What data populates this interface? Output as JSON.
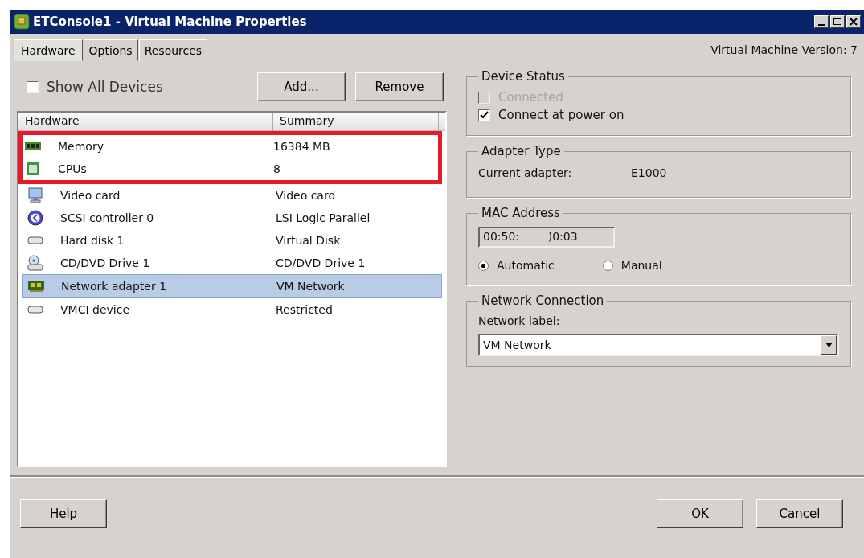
{
  "window": {
    "title": "ETConsole1 - Virtual Machine Properties",
    "version": "Virtual Machine Version: 7"
  },
  "tabs": [
    {
      "label": "Hardware",
      "selected": true
    },
    {
      "label": "Options",
      "selected": false
    },
    {
      "label": "Resources",
      "selected": false
    }
  ],
  "show_all_devices": {
    "label": "Show All Devices",
    "checked": false
  },
  "list_buttons": [
    "Add...",
    "Remove"
  ],
  "table": {
    "columns": [
      "Hardware",
      "Summary"
    ],
    "rows": [
      {
        "kind": "memory",
        "name": "Memory",
        "summary": "16384 MB",
        "selected": false,
        "highlighted": true
      },
      {
        "kind": "cpu",
        "name": "CPUs",
        "summary": "8",
        "selected": false,
        "highlighted": true
      },
      {
        "kind": "video",
        "name": "Video card",
        "summary": "Video card",
        "selected": false,
        "highlighted": false
      },
      {
        "kind": "scsi",
        "name": "SCSI controller 0",
        "summary": "LSI Logic Parallel",
        "selected": false,
        "highlighted": false
      },
      {
        "kind": "disk",
        "name": "Hard disk 1",
        "summary": "Virtual Disk",
        "selected": false,
        "highlighted": false
      },
      {
        "kind": "cdrom",
        "name": "CD/DVD Drive 1",
        "summary": "CD/DVD Drive 1",
        "selected": false,
        "highlighted": false
      },
      {
        "kind": "network",
        "name": "Network adapter 1",
        "summary": "VM Network",
        "selected": true,
        "highlighted": false
      },
      {
        "kind": "disk",
        "name": "VMCI device",
        "summary": "Restricted",
        "selected": false,
        "highlighted": false
      }
    ]
  },
  "device_status": {
    "title": "Device Status",
    "options": [
      {
        "label": "Connected",
        "checked": false,
        "disabled": true
      },
      {
        "label": "Connect at power on",
        "checked": true,
        "disabled": false
      }
    ]
  },
  "adapter_type": {
    "title": "Adapter Type",
    "label": "Current adapter:",
    "value": "E1000"
  },
  "mac_address": {
    "title": "MAC Address",
    "value": "00:50:        )0:03",
    "modes": [
      {
        "label": "Automatic",
        "selected": true
      },
      {
        "label": "Manual",
        "selected": false
      }
    ]
  },
  "network_connection": {
    "title": "Network Connection",
    "label": "Network label:",
    "value": "VM Network"
  },
  "footer": {
    "left_buttons": [
      "Help"
    ],
    "right_buttons": [
      "OK",
      "Cancel"
    ]
  }
}
